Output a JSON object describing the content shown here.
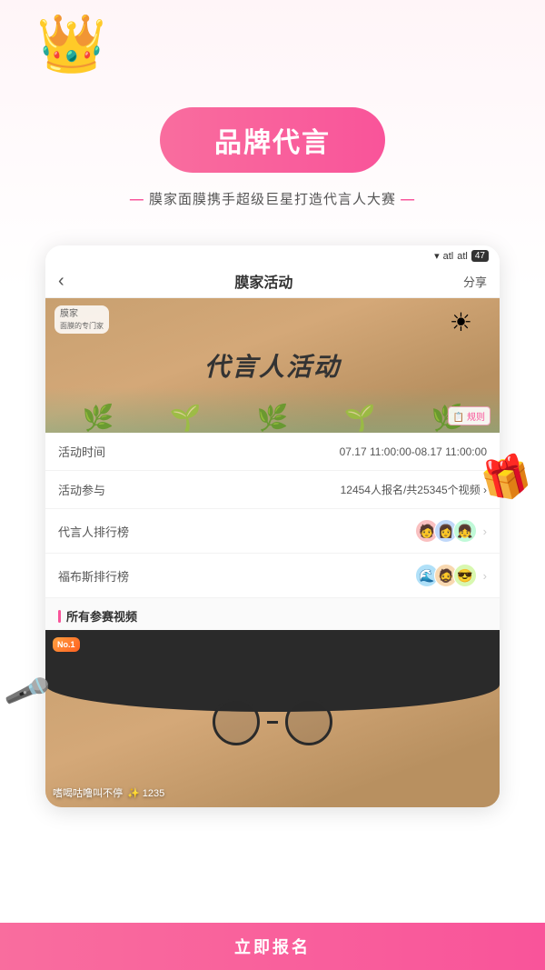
{
  "page": {
    "background": "#fff5f8"
  },
  "crown": {
    "emoji": "👑"
  },
  "brand": {
    "badge_label": "品牌代言"
  },
  "subtitle": {
    "prefix": "—",
    "text": " 膜家面膜携手超级巨星打造代言人大赛 ",
    "suffix": "—"
  },
  "phone": {
    "status": {
      "wifi": "▾",
      "signal1": "atl",
      "signal2": "atl",
      "battery_icon": "▉",
      "battery_level": "47"
    },
    "nav": {
      "back": "‹",
      "title": "膜家活动",
      "share": "分享"
    },
    "banner": {
      "logo_line1": "膜家",
      "logo_line2": "面膜的专门家",
      "sun": "☀",
      "title": "代言人活动",
      "rules_label": "📋 规则"
    },
    "info_rows": [
      {
        "label": "活动时间",
        "value": "07.17 11:00:00-08.17 11:00:00",
        "type": "text"
      },
      {
        "label": "活动参与",
        "value": "12454人报名/共25345个视频 ›",
        "type": "text"
      },
      {
        "label": "代言人排行榜",
        "type": "avatars",
        "avatars": [
          "🧑",
          "👩",
          "👧"
        ]
      },
      {
        "label": "福布斯排行榜",
        "type": "avatars",
        "avatars": [
          "🌊",
          "🧔",
          "😎"
        ]
      }
    ],
    "section": {
      "bar_color": "#f9549a",
      "label": "所有参赛视频"
    },
    "video": {
      "no1_label": "No.1",
      "user_name": "嗜喝咕噜叫不停",
      "star_emoji": "✨",
      "star_count": "1235"
    },
    "register_btn": {
      "label": "立即报名"
    }
  },
  "decorations": {
    "treasure": "🎁",
    "mic": "🎤"
  }
}
